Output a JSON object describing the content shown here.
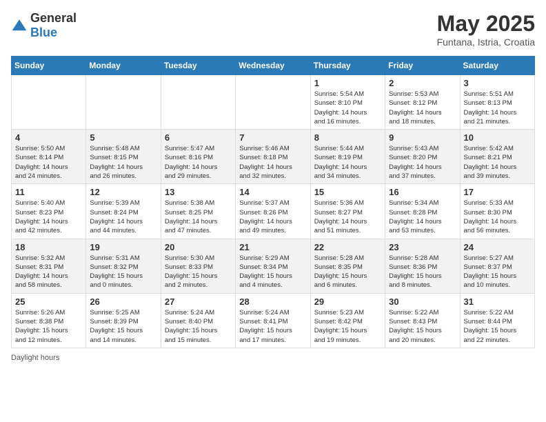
{
  "header": {
    "logo_general": "General",
    "logo_blue": "Blue",
    "month_title": "May 2025",
    "location": "Funtana, Istria, Croatia"
  },
  "days_of_week": [
    "Sunday",
    "Monday",
    "Tuesday",
    "Wednesday",
    "Thursday",
    "Friday",
    "Saturday"
  ],
  "weeks": [
    [
      {
        "day": "",
        "info": ""
      },
      {
        "day": "",
        "info": ""
      },
      {
        "day": "",
        "info": ""
      },
      {
        "day": "",
        "info": ""
      },
      {
        "day": "1",
        "info": "Sunrise: 5:54 AM\nSunset: 8:10 PM\nDaylight: 14 hours\nand 16 minutes."
      },
      {
        "day": "2",
        "info": "Sunrise: 5:53 AM\nSunset: 8:12 PM\nDaylight: 14 hours\nand 18 minutes."
      },
      {
        "day": "3",
        "info": "Sunrise: 5:51 AM\nSunset: 8:13 PM\nDaylight: 14 hours\nand 21 minutes."
      }
    ],
    [
      {
        "day": "4",
        "info": "Sunrise: 5:50 AM\nSunset: 8:14 PM\nDaylight: 14 hours\nand 24 minutes."
      },
      {
        "day": "5",
        "info": "Sunrise: 5:48 AM\nSunset: 8:15 PM\nDaylight: 14 hours\nand 26 minutes."
      },
      {
        "day": "6",
        "info": "Sunrise: 5:47 AM\nSunset: 8:16 PM\nDaylight: 14 hours\nand 29 minutes."
      },
      {
        "day": "7",
        "info": "Sunrise: 5:46 AM\nSunset: 8:18 PM\nDaylight: 14 hours\nand 32 minutes."
      },
      {
        "day": "8",
        "info": "Sunrise: 5:44 AM\nSunset: 8:19 PM\nDaylight: 14 hours\nand 34 minutes."
      },
      {
        "day": "9",
        "info": "Sunrise: 5:43 AM\nSunset: 8:20 PM\nDaylight: 14 hours\nand 37 minutes."
      },
      {
        "day": "10",
        "info": "Sunrise: 5:42 AM\nSunset: 8:21 PM\nDaylight: 14 hours\nand 39 minutes."
      }
    ],
    [
      {
        "day": "11",
        "info": "Sunrise: 5:40 AM\nSunset: 8:23 PM\nDaylight: 14 hours\nand 42 minutes."
      },
      {
        "day": "12",
        "info": "Sunrise: 5:39 AM\nSunset: 8:24 PM\nDaylight: 14 hours\nand 44 minutes."
      },
      {
        "day": "13",
        "info": "Sunrise: 5:38 AM\nSunset: 8:25 PM\nDaylight: 14 hours\nand 47 minutes."
      },
      {
        "day": "14",
        "info": "Sunrise: 5:37 AM\nSunset: 8:26 PM\nDaylight: 14 hours\nand 49 minutes."
      },
      {
        "day": "15",
        "info": "Sunrise: 5:36 AM\nSunset: 8:27 PM\nDaylight: 14 hours\nand 51 minutes."
      },
      {
        "day": "16",
        "info": "Sunrise: 5:34 AM\nSunset: 8:28 PM\nDaylight: 14 hours\nand 53 minutes."
      },
      {
        "day": "17",
        "info": "Sunrise: 5:33 AM\nSunset: 8:30 PM\nDaylight: 14 hours\nand 56 minutes."
      }
    ],
    [
      {
        "day": "18",
        "info": "Sunrise: 5:32 AM\nSunset: 8:31 PM\nDaylight: 14 hours\nand 58 minutes."
      },
      {
        "day": "19",
        "info": "Sunrise: 5:31 AM\nSunset: 8:32 PM\nDaylight: 15 hours\nand 0 minutes."
      },
      {
        "day": "20",
        "info": "Sunrise: 5:30 AM\nSunset: 8:33 PM\nDaylight: 15 hours\nand 2 minutes."
      },
      {
        "day": "21",
        "info": "Sunrise: 5:29 AM\nSunset: 8:34 PM\nDaylight: 15 hours\nand 4 minutes."
      },
      {
        "day": "22",
        "info": "Sunrise: 5:28 AM\nSunset: 8:35 PM\nDaylight: 15 hours\nand 6 minutes."
      },
      {
        "day": "23",
        "info": "Sunrise: 5:28 AM\nSunset: 8:36 PM\nDaylight: 15 hours\nand 8 minutes."
      },
      {
        "day": "24",
        "info": "Sunrise: 5:27 AM\nSunset: 8:37 PM\nDaylight: 15 hours\nand 10 minutes."
      }
    ],
    [
      {
        "day": "25",
        "info": "Sunrise: 5:26 AM\nSunset: 8:38 PM\nDaylight: 15 hours\nand 12 minutes."
      },
      {
        "day": "26",
        "info": "Sunrise: 5:25 AM\nSunset: 8:39 PM\nDaylight: 15 hours\nand 14 minutes."
      },
      {
        "day": "27",
        "info": "Sunrise: 5:24 AM\nSunset: 8:40 PM\nDaylight: 15 hours\nand 15 minutes."
      },
      {
        "day": "28",
        "info": "Sunrise: 5:24 AM\nSunset: 8:41 PM\nDaylight: 15 hours\nand 17 minutes."
      },
      {
        "day": "29",
        "info": "Sunrise: 5:23 AM\nSunset: 8:42 PM\nDaylight: 15 hours\nand 19 minutes."
      },
      {
        "day": "30",
        "info": "Sunrise: 5:22 AM\nSunset: 8:43 PM\nDaylight: 15 hours\nand 20 minutes."
      },
      {
        "day": "31",
        "info": "Sunrise: 5:22 AM\nSunset: 8:44 PM\nDaylight: 15 hours\nand 22 minutes."
      }
    ]
  ],
  "footer": {
    "daylight_label": "Daylight hours"
  }
}
